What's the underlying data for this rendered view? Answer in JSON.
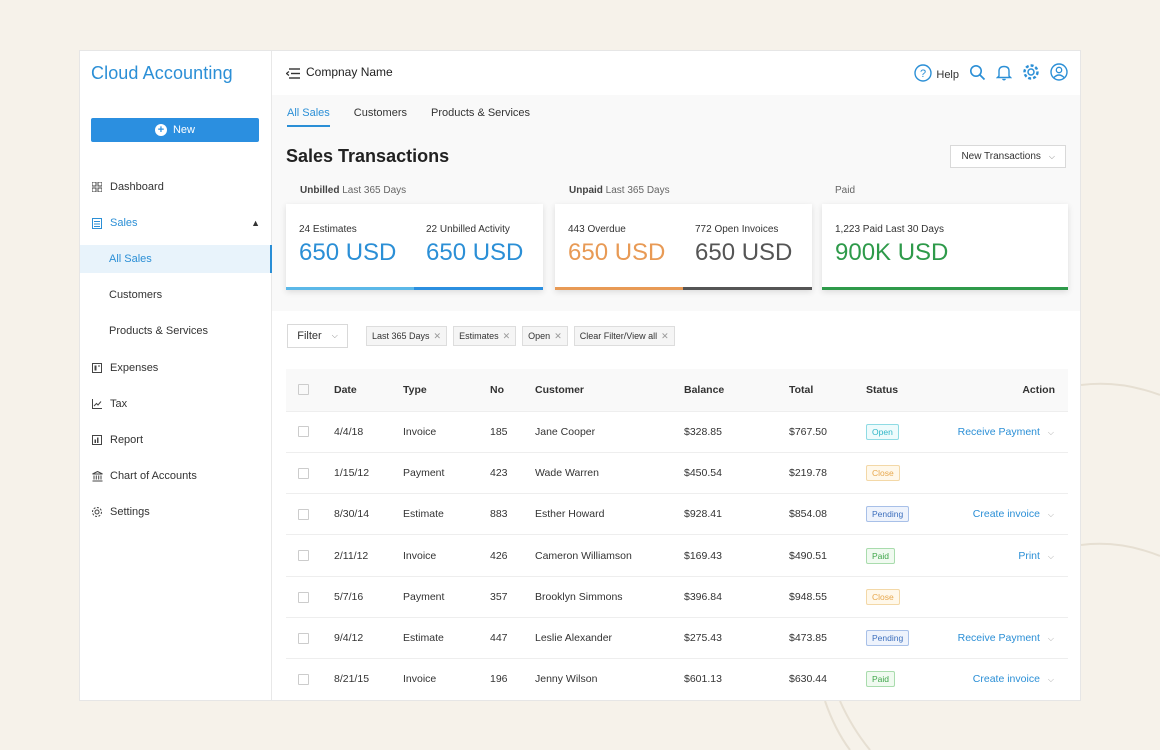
{
  "brand": "Cloud Accounting",
  "new_button": "New",
  "company_name": "Compnay Name",
  "help_label": "Help",
  "sidebar": {
    "items": [
      {
        "label": "Dashboard",
        "icon": "grid-icon"
      },
      {
        "label": "Sales",
        "icon": "list-icon"
      },
      {
        "label": "All Sales"
      },
      {
        "label": "Customers"
      },
      {
        "label": "Products & Services"
      },
      {
        "label": "Expenses",
        "icon": "expenses-icon"
      },
      {
        "label": "Tax",
        "icon": "chart-icon"
      },
      {
        "label": "Report",
        "icon": "report-icon"
      },
      {
        "label": "Chart of Accounts",
        "icon": "bank-icon"
      },
      {
        "label": "Settings",
        "icon": "gear-icon"
      }
    ]
  },
  "tabs": [
    "All Sales",
    "Customers",
    "Products & Services"
  ],
  "page_title": "Sales Transactions",
  "new_transactions": "New Transactions",
  "summary": {
    "unbilled": {
      "bold": "Unbilled",
      "rest": "Last 365 Days"
    },
    "unpaid": {
      "bold": "Unpaid",
      "rest": "Last 365 Days"
    },
    "paid": {
      "label": "Paid"
    }
  },
  "metrics": [
    {
      "label": "24 Estimates",
      "value": "650 USD",
      "color": "#2b8fd6"
    },
    {
      "label": "22 Unbilled Activity",
      "value": "650 USD",
      "color": "#2b8fd6"
    },
    {
      "label": "443 Overdue",
      "value": "650 USD",
      "color": "#e89a55"
    },
    {
      "label": "772 Open Invoices",
      "value": "650 USD",
      "color": "#555555"
    },
    {
      "label": "1,223 Paid Last 30 Days",
      "value": "900K USD",
      "color": "#2e9a4a"
    }
  ],
  "filter_label": "Filter",
  "chips": [
    "Last 365 Days",
    "Estimates",
    "Open",
    "Clear Filter/View all"
  ],
  "table": {
    "headers": [
      "Date",
      "Type",
      "No",
      "Customer",
      "Balance",
      "Total",
      "Status",
      "Action"
    ],
    "rows": [
      {
        "date": "4/4/18",
        "type": "Invoice",
        "no": "185",
        "customer": "Jane Cooper",
        "balance": "$328.85",
        "total": "$767.50",
        "status": "Open",
        "action": "Receive Payment"
      },
      {
        "date": "1/15/12",
        "type": "Payment",
        "no": "423",
        "customer": "Wade Warren",
        "balance": "$450.54",
        "total": "$219.78",
        "status": "Close",
        "action": ""
      },
      {
        "date": "8/30/14",
        "type": "Estimate",
        "no": "883",
        "customer": "Esther Howard",
        "balance": "$928.41",
        "total": "$854.08",
        "status": "Pending",
        "action": "Create invoice"
      },
      {
        "date": "2/11/12",
        "type": "Invoice",
        "no": "426",
        "customer": "Cameron Williamson",
        "balance": "$169.43",
        "total": "$490.51",
        "status": "Paid",
        "action": "Print"
      },
      {
        "date": "5/7/16",
        "type": "Payment",
        "no": "357",
        "customer": "Brooklyn Simmons",
        "balance": "$396.84",
        "total": "$948.55",
        "status": "Close",
        "action": ""
      },
      {
        "date": "9/4/12",
        "type": "Estimate",
        "no": "447",
        "customer": "Leslie Alexander",
        "balance": "$275.43",
        "total": "$473.85",
        "status": "Pending",
        "action": "Receive Payment"
      },
      {
        "date": "8/21/15",
        "type": "Invoice",
        "no": "196",
        "customer": "Jenny Wilson",
        "balance": "$601.13",
        "total": "$630.44",
        "status": "Paid",
        "action": "Create invoice"
      }
    ]
  },
  "colors": {
    "accent": "#2b8fd6",
    "unbilled_bar": "#5bb8e8",
    "overdue_bar": "#e89a55",
    "open_bar": "#555555",
    "paid_bar": "#2e9a4a"
  }
}
